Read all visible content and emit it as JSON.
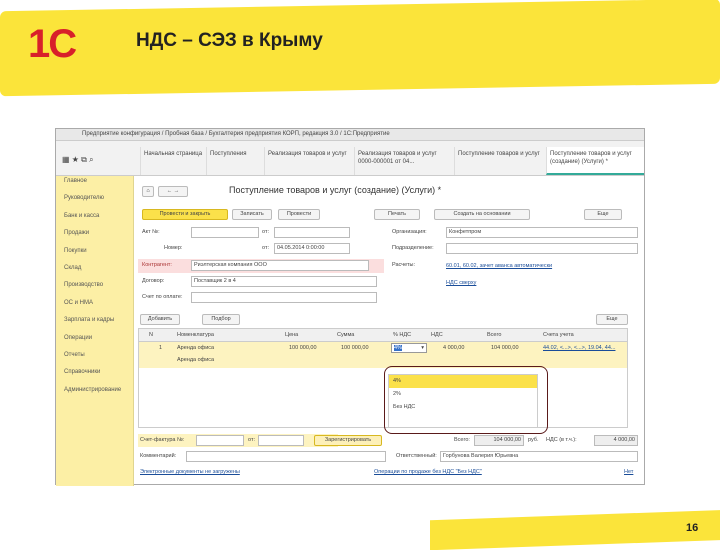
{
  "slide": {
    "title": "НДС – СЭЗ в Крыму",
    "page_number": "16",
    "logo_text": "1С"
  },
  "window": {
    "title": "Предприятие конфигурация / Пробная база / Бухгалтерия предприятия КОРП, редакция 3.0 / 1С:Предприятие"
  },
  "tabs": [
    {
      "label": "Начальная страница"
    },
    {
      "label": "Поступления"
    },
    {
      "label": "Реализация товаров и услуг"
    },
    {
      "label": "Реализация товаров и услуг 0000-000001 от 04..."
    },
    {
      "label": "Поступление товаров и услуг"
    },
    {
      "label": "Поступление товаров и услуг (создание) (Услуги) *"
    }
  ],
  "sidebar": {
    "items": [
      "Главное",
      "Руководителю",
      "Банк и касса",
      "Продажи",
      "Покупки",
      "Склад",
      "Производство",
      "ОС и НМА",
      "Зарплата и кадры",
      "Операции",
      "Отчеты",
      "Справочники",
      "Администрирование"
    ]
  },
  "form": {
    "title": "Поступление товаров и услуг (создание) (Услуги) *",
    "buttons": {
      "post_close": "Провести и закрыть",
      "save": "Записать",
      "post": "Провести",
      "print": "Печать",
      "create_based": "Создать на основании",
      "more": "Еще"
    },
    "fields": {
      "act_label": "Акт №:",
      "act_from": "от:",
      "number_label": "Номер:",
      "date_from": "от:",
      "date": "04.05.2014 0:00:00",
      "counterparty_label": "Контрагент:",
      "counterparty": "Риэлтерская компания ООО",
      "contract_label": "Договор:",
      "contract": "Поставщик 2 в 4",
      "account_label": "Счет по оплате:",
      "organization_label": "Организация:",
      "organization": "Конфетпром",
      "division_label": "Подразделение:",
      "accounts_label": "Расчеты:",
      "accounts_link": "60.01, 60.02, зачет аванса автоматически",
      "vat_link": "НДС сверху"
    },
    "table_buttons": {
      "add": "Добавить",
      "pick": "Подбор",
      "more": "Еще"
    },
    "columns": [
      "N",
      "Номенклатура",
      "Цена",
      "Сумма",
      "% НДС",
      "НДС",
      "Всего",
      "Счета учета"
    ],
    "rows": [
      {
        "n": "1",
        "item": "Аренда офиса",
        "item2": "Аренда офиса",
        "price": "100 000,00",
        "sum": "100 000,00",
        "vat_rate": "4%",
        "vat": "4 000,00",
        "total": "104 000,00",
        "accounts": "44.02, <...>, <...>, 19.04, 44..."
      }
    ],
    "vat_dropdown": {
      "options": [
        "4%",
        "2%",
        "Без НДС"
      ],
      "selected": "4%"
    },
    "footer": {
      "invoice_label": "Счет-фактура №:",
      "invoice_from": "от:",
      "register": "Зарегистрировать",
      "total_label": "Всего:",
      "total": "104 000,00",
      "currency": "руб.",
      "vat_label": "НДС (в т.ч.):",
      "vat_total": "4 000,00",
      "comment_label": "Комментарий:",
      "responsible_label": "Ответственный:",
      "responsible": "Горбунова Валерия Юрьевна",
      "link_left": "Электронные документы не загружены",
      "link_mid": "Операции по продаже без НДС \"Без НДС\"",
      "link_right": "Нет"
    }
  },
  "colors": {
    "accent_yellow": "#fbe43a",
    "logo_red": "#d8202a",
    "sidebar": "#fcefa5"
  }
}
